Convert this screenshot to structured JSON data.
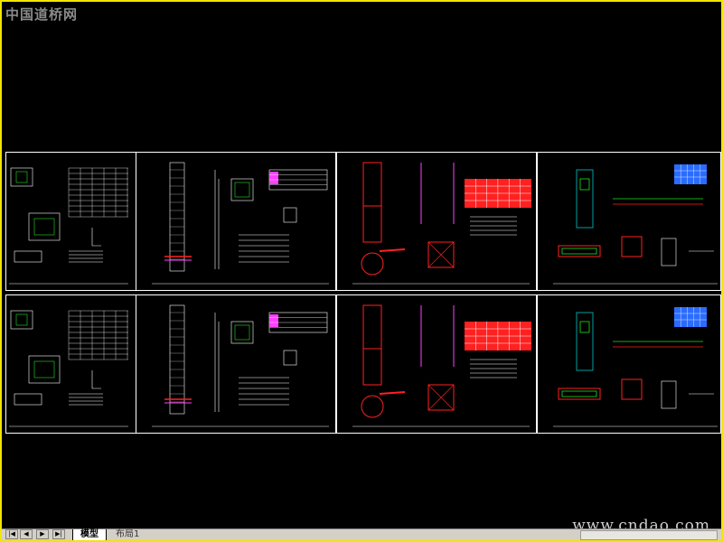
{
  "watermarks": {
    "top": "中国道桥网",
    "bottom": "www.cndao.com"
  },
  "tabs": [
    {
      "label": "模型"
    },
    {
      "label": "布局1"
    }
  ],
  "navigation": {
    "first": "|◀",
    "prev": "◀",
    "next": "▶",
    "last": "▶|"
  },
  "colors": {
    "background": "#000000",
    "frame_border": "#f2e600",
    "sheet_border": "#ffffff",
    "drawing_red": "#ff2020",
    "drawing_magenta": "#ff40ff",
    "drawing_green": "#20e020",
    "drawing_cyan": "#00c8c8",
    "drawing_blue": "#2a6cff"
  }
}
